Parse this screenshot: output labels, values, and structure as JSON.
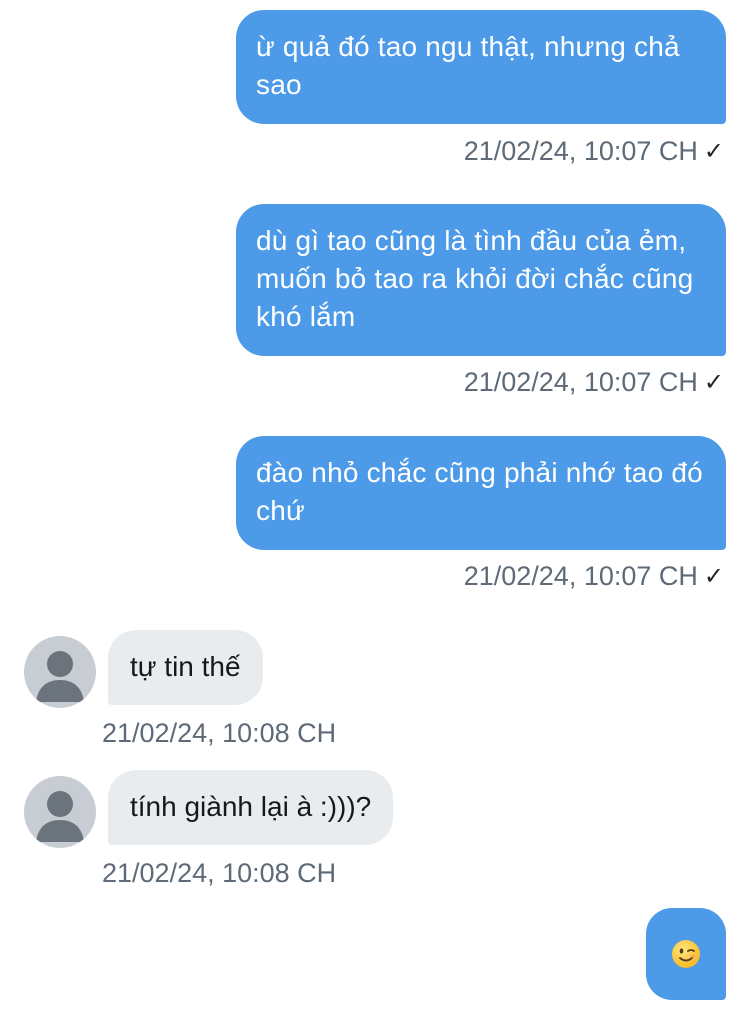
{
  "messages": {
    "m1": {
      "text": "ừ quả đó tao ngu thật, nhưng chả sao",
      "time": "21/02/24, 10:07 CH",
      "status": "✓"
    },
    "m2": {
      "text": "dù gì tao cũng là tình đầu của ẻm, muốn bỏ tao ra khỏi đời chắc cũng khó lắm",
      "time": "21/02/24, 10:07 CH",
      "status": "✓"
    },
    "m3": {
      "text": "đào nhỏ chắc cũng phải nhớ tao đó chứ",
      "time": "21/02/24, 10:07 CH",
      "status": "✓"
    },
    "r1": {
      "text": "tự tin thế",
      "time": "21/02/24, 10:08 CH"
    },
    "r2": {
      "text": "tính giành lại à :)))?",
      "time": "21/02/24, 10:08 CH"
    },
    "m4": {
      "emoji": "winking-face"
    }
  },
  "colors": {
    "sent_bubble": "#4d9be8",
    "received_bubble": "#e9ecef",
    "timestamp": "#5e6a77",
    "avatar_bg": "#c8cdd3",
    "avatar_fg": "#6b737c"
  }
}
